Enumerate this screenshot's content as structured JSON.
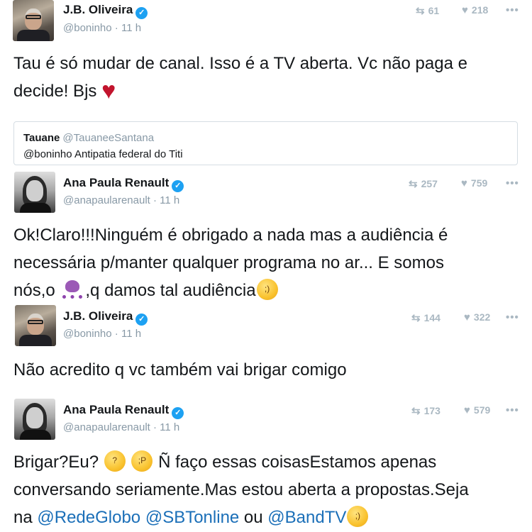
{
  "tweets": [
    {
      "name": "J.B. Oliveira",
      "handle": "@boninho",
      "time": "11 h",
      "retweets": "61",
      "likes": "218",
      "text_parts": [
        "Tau é só mudar de canal. Isso é a TV aberta. Vc não paga e",
        "decide! Bjs"
      ],
      "quote": {
        "name": "Tauane",
        "handle": "@TauaneeSantana",
        "text": "@boninho Antipatia federal do Titi"
      }
    },
    {
      "name": "Ana Paula Renault",
      "handle": "@anapaularenault",
      "time": "11 h",
      "retweets": "257",
      "likes": "759",
      "text_parts": [
        "Ok!Claro!!!Ninguém é obrigado a nada mas a audiência é",
        "necessária p/manter qualquer programa no ar... E somos",
        "nós,o ",
        ",q damos tal audiência"
      ]
    },
    {
      "name": "J.B. Oliveira",
      "handle": "@boninho",
      "time": "11 h",
      "retweets": "144",
      "likes": "322",
      "text_parts": [
        "Não acredito q vc também vai brigar comigo"
      ]
    },
    {
      "name": "Ana Paula Renault",
      "handle": "@anapaularenault",
      "time": "11 h",
      "retweets": "173",
      "likes": "579",
      "text_parts": [
        "Brigar?Eu? ",
        " Ñ faço essas coisasEstamos apenas",
        "conversando seriamente.Mas estou aberta a propostas.Seja",
        "na ",
        " ou "
      ],
      "mentions": [
        "@RedeGlobo",
        "@SBTonline",
        "@BandTV"
      ]
    }
  ],
  "glyphs": {
    "retweet": "⇆",
    "like": "♥",
    "more": "•••",
    "verified": "✓",
    "heart_emoji": "♥",
    "dot": "·"
  },
  "colors": {
    "link": "#1b6fb8",
    "verified": "#1da1f2",
    "muted": "#8899a6",
    "heart": "#c2142d"
  }
}
